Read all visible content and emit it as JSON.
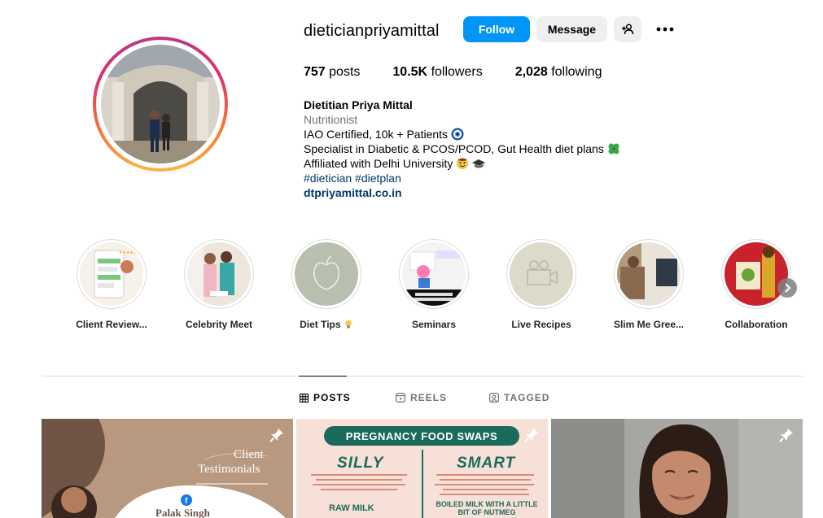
{
  "profile": {
    "username": "dieticianpriyamittal",
    "follow_label": "Follow",
    "message_label": "Message",
    "stats": {
      "posts_count": "757",
      "posts_label": "posts",
      "followers_count": "10.5K",
      "followers_label": "followers",
      "following_count": "2,028",
      "following_label": "following"
    },
    "bio": {
      "name": "Dietitian Priya Mittal",
      "category": "Nutritionist",
      "line1": "IAO Certified, 10k + Patients",
      "line2": "Specialist in Diabetic & PCOS/PCOD, Gut Health diet plans",
      "line3": "Affiliated with Delhi University",
      "hashtags": "#dietician #dietplan",
      "link": "dtpriyamittal.co.in"
    }
  },
  "highlights": [
    {
      "label": "Client Review..."
    },
    {
      "label": "Celebrity Meet"
    },
    {
      "label": "Diet Tips"
    },
    {
      "label": "Seminars"
    },
    {
      "label": "Live Recipes"
    },
    {
      "label": "Slim Me Gree..."
    },
    {
      "label": "Collaboration"
    }
  ],
  "tabs": [
    {
      "label": "POSTS"
    },
    {
      "label": "REELS"
    },
    {
      "label": "TAGGED"
    }
  ],
  "posts": {
    "post1": {
      "title_line1": "Client",
      "title_line2": "Testimonials",
      "name": "Palak Singh"
    },
    "post2": {
      "header": "PREGNANCY FOOD SWAPS",
      "left_title": "SILLY",
      "right_title": "SMART",
      "left_bottom": "RAW MILK",
      "right_bottom": "BOILED MILK WITH A LITTLE BIT OF NUTMEG"
    }
  },
  "colors": {
    "follow_blue": "#0095f6",
    "link_blue": "#00376b",
    "secondary_gray": "#737373",
    "button_gray": "#efefef",
    "divider": "#dbdbdb"
  }
}
